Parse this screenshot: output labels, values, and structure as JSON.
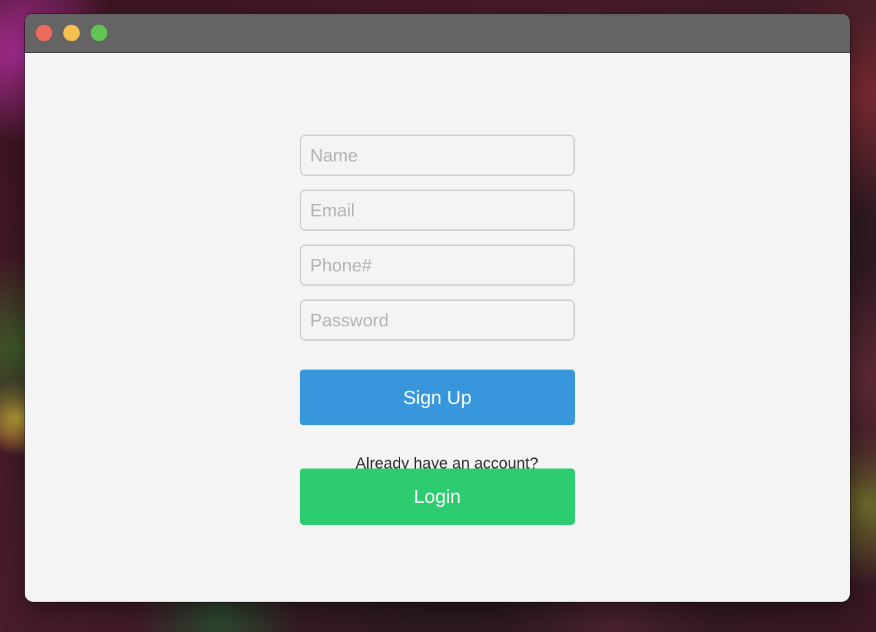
{
  "window": {
    "controls": [
      "close",
      "minimize",
      "zoom"
    ],
    "colors": {
      "close": "#ed6a5e",
      "minimize": "#f5bf4f",
      "zoom": "#61c554"
    }
  },
  "form": {
    "name_placeholder": "Name",
    "name_value": "",
    "email_placeholder": "Email",
    "email_value": "",
    "phone_placeholder": "Phone#",
    "phone_value": "",
    "password_placeholder": "Password",
    "password_value": "",
    "signup_label": "Sign Up",
    "signup_color": "#3897dc",
    "prompt_text": "Already have an account?",
    "login_label": "Login",
    "login_color": "#2ecc71"
  }
}
